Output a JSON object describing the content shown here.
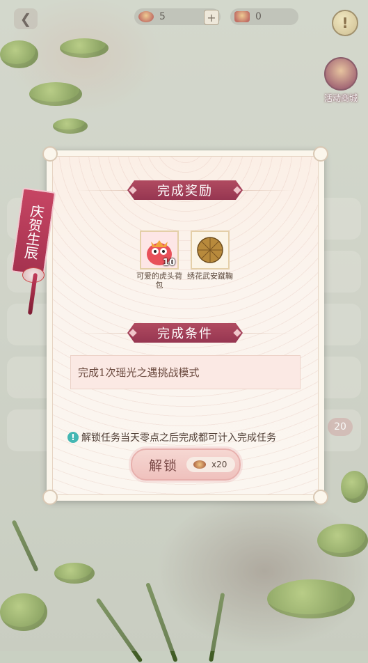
{
  "topbar": {
    "resource1_value": "5",
    "resource2_value": "0",
    "plus_label": "+",
    "alert_label": "!"
  },
  "shop": {
    "label": "活动商城"
  },
  "side_badge": "20",
  "tag": {
    "text": "庆贺生辰"
  },
  "modal": {
    "reward_title": "完成奖励",
    "rewards": [
      {
        "name": "可爱的虎头荷包",
        "qty": "10"
      },
      {
        "name": "绣花武安蹴鞠",
        "qty": ""
      }
    ],
    "condition_title": "完成条件",
    "condition_text": "完成1次瑶光之遇挑战模式",
    "tip_text": "解锁任务当天零点之后完成都可计入完成任务",
    "unlock_label": "解锁",
    "unlock_cost": "x20"
  },
  "colors": {
    "ribbon": "#a8425a",
    "accent_info": "#44b7b3",
    "button": "#f2cbc6"
  }
}
